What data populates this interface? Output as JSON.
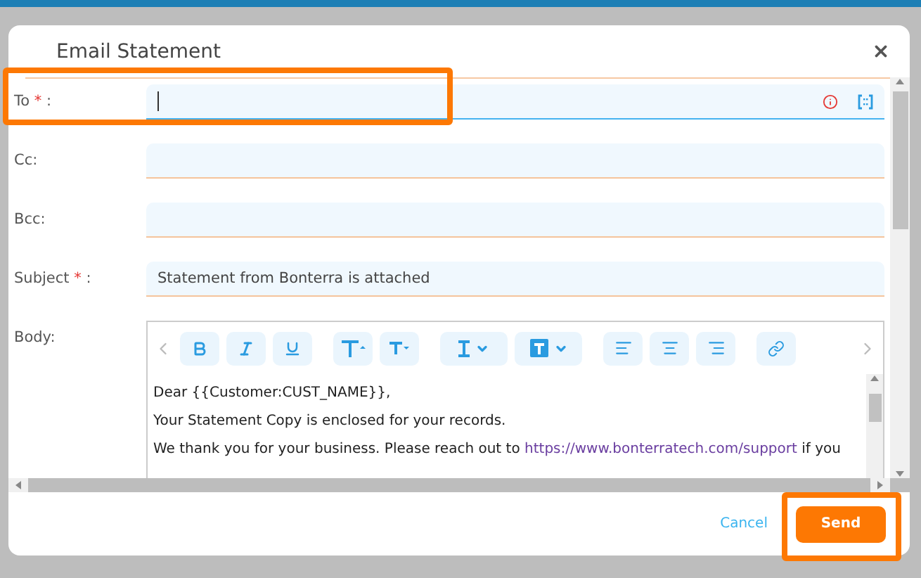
{
  "dialog": {
    "title": "Email Statement"
  },
  "fields": [
    {
      "label": "To",
      "required_mark": "*",
      "colon": ":",
      "focused": true,
      "highlighted": true
    },
    {
      "label": "Cc:",
      "focused": false,
      "highlighted": false
    },
    {
      "label": "Bcc:",
      "focused": false,
      "highlighted": false
    },
    {
      "label": "Subject",
      "required_mark": "*",
      "colon": ":",
      "value": "Statement from Bonterra is attached",
      "focused": false,
      "highlighted": false
    }
  ],
  "body": {
    "label": "Body:",
    "toolbar": [
      {
        "kind": "bold"
      },
      {
        "kind": "italic"
      },
      {
        "kind": "underline"
      },
      {
        "kind": "size-up"
      },
      {
        "kind": "size-down"
      },
      {
        "kind": "text-color"
      },
      {
        "kind": "highlight-color"
      },
      {
        "kind": "align-left"
      },
      {
        "kind": "align-center"
      },
      {
        "kind": "align-right"
      },
      {
        "kind": "link"
      }
    ],
    "paragraphs": [
      {
        "text": "Dear {{Customer:CUST_NAME}},"
      },
      {
        "text": "Your Statement Copy is enclosed for your records."
      },
      {
        "text": "We thank you for your business. Please reach out to",
        "link": "https://www.bonterratech.com/support",
        "after": "if you"
      }
    ]
  },
  "footer": {
    "cancel": "Cancel",
    "send": {
      "label": "Send",
      "highlighted": true
    }
  }
}
